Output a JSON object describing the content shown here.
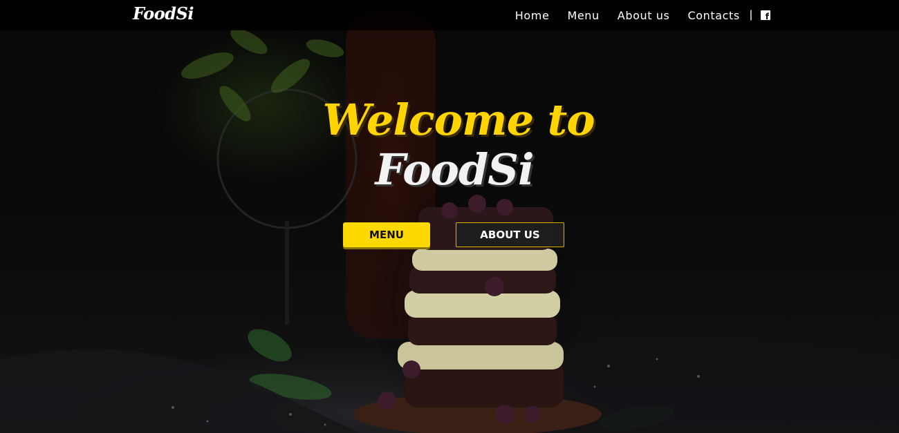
{
  "header": {
    "logo": "FoodSi",
    "nav": [
      "Home",
      "Menu",
      "About us",
      "Contacts"
    ],
    "separator": "|",
    "social_icon": "facebook-icon"
  },
  "hero": {
    "title_line1": "Welcome to",
    "title_line2": "FoodSi",
    "menu_button": "MENU",
    "about_button": "ABOUT US",
    "background_image": "dark photo of a layered berry cream cake with a wine glass and flowers"
  },
  "colors": {
    "accent": "#ffd800",
    "nav_background": "#000000",
    "text": "#ffffff"
  }
}
